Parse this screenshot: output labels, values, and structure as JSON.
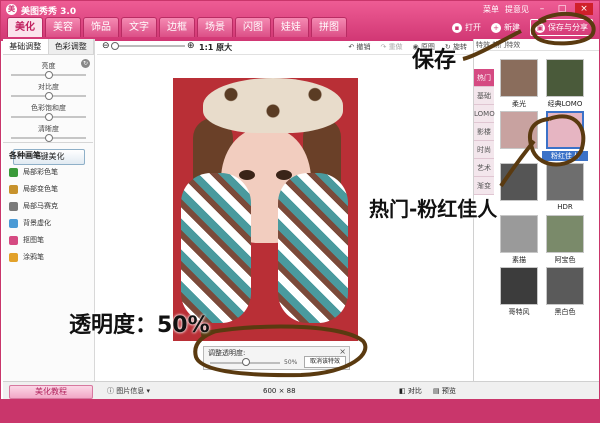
{
  "app": {
    "title": "美图秀秀 3.0"
  },
  "titlebar_right": [
    "菜单",
    "提意见"
  ],
  "main_tabs": [
    "美化",
    "美容",
    "饰品",
    "文字",
    "边框",
    "场景",
    "闪图",
    "娃娃",
    "拼图"
  ],
  "actions": {
    "open": "打开",
    "new": "新建",
    "save_share": "保存与分享"
  },
  "left": {
    "subtabs": [
      "基础调整",
      "色彩调整"
    ],
    "sliders": [
      {
        "label": "亮度",
        "value": 0.5
      },
      {
        "label": "对比度",
        "value": 0.5
      },
      {
        "label": "色彩饱和度",
        "value": 0.5
      },
      {
        "label": "清晰度",
        "value": 0.5
      }
    ],
    "one_key": "一键美化",
    "brush_title": "各种画笔",
    "brushes": [
      {
        "label": "局部彩色笔",
        "color": "#3a9a3a"
      },
      {
        "label": "局部变色笔",
        "color": "#c7922c"
      },
      {
        "label": "局部马赛克",
        "color": "#7a7a7a"
      },
      {
        "label": "背景虚化",
        "color": "#4b9ad5"
      },
      {
        "label": "抠图笔",
        "color": "#d54a82"
      },
      {
        "label": "涂鸦笔",
        "color": "#e2a12a"
      }
    ]
  },
  "toolbar": {
    "zoom_label": "1:1 原大",
    "undo": "撤销",
    "redo": "重做",
    "original": "原图",
    "rotate": "旋转"
  },
  "opacity_dialog": {
    "title": "调整透明度:",
    "value": "50%",
    "cancel": "取消该特效",
    "level": 0.5
  },
  "right": {
    "header": "特效   热门特效",
    "categories": [
      "热门",
      "基础",
      "LOMO",
      "影楼",
      "时尚",
      "艺术",
      "渐变"
    ],
    "thumbs": [
      {
        "label": "柔光",
        "color": "#8a6d5c",
        "selected": false
      },
      {
        "label": "经典LOMO",
        "color": "#4a5a3a",
        "selected": false
      },
      {
        "label": "",
        "color": "#c8a2a0",
        "selected": false
      },
      {
        "label": "粉红佳人",
        "color": "#e6b5c2",
        "selected": true
      },
      {
        "label": "",
        "color": "#555555",
        "selected": false
      },
      {
        "label": "HDR",
        "color": "#6e6e6e",
        "selected": false
      },
      {
        "label": "素描",
        "color": "#9a9a9a",
        "selected": false
      },
      {
        "label": "阿宝色",
        "color": "#7a8a6a",
        "selected": false
      },
      {
        "label": "哥特风",
        "color": "#3c3c3c",
        "selected": false
      },
      {
        "label": "黑白色",
        "color": "#5a5a5a",
        "selected": false
      }
    ]
  },
  "bottom": {
    "tutorial": "美化教程",
    "image_info": "图片信息",
    "dims": "600 × 88",
    "compare": "对比",
    "preview": "预览"
  },
  "annotations": {
    "save": "保存",
    "hot": "热门-粉红佳人",
    "opacity": "透明度：50%"
  }
}
